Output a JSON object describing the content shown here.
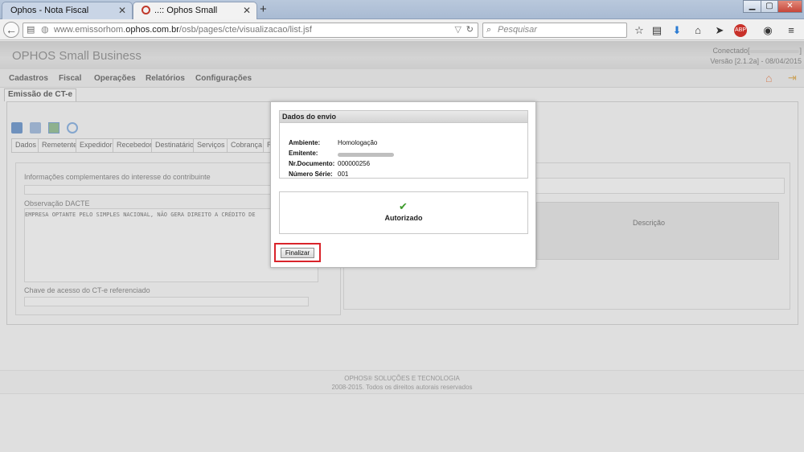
{
  "browser": {
    "tabs": [
      {
        "label": "Ophos - Nota Fiscal Eletrônica",
        "active": false
      },
      {
        "label": "..:: Ophos Small Business",
        "active": true
      }
    ],
    "new_tab_label": "+",
    "url_prefix": "www.emissorhom.",
    "url_domain": "ophos.com.br",
    "url_path": "/osb/pages/cte/visualizacao/list.jsf",
    "search_placeholder": "Pesquisar"
  },
  "app": {
    "brand": "OPHOS Small Business",
    "connected_label": "Conectado[",
    "connected_suffix": "]",
    "version": "Versão [2.1.2a] - 08/04/2015",
    "menu": [
      "Cadastros",
      "Fiscal",
      "Operações",
      "Relatórios",
      "Configurações"
    ],
    "page_tab": "Emissão de CT-e",
    "inner_tabs": [
      "Dados",
      "Remetente",
      "Expedidor",
      "Recebedor",
      "Destinatário",
      "Serviços",
      "Cobrança",
      "R"
    ],
    "form": {
      "info_label": "Informações complementares do interesse do contribuinte",
      "obs_label": "Observação DACTE",
      "obs_text": "EMPRESA OPTANTE PELO SIMPLES NACIONAL, NÃO GERA DIREITO A CRÉDITO DE",
      "chave_label": "Chave de acesso do CT-e referenciado"
    },
    "grid_header": "Descrição"
  },
  "modal": {
    "title": "Dados do envio",
    "fields": [
      {
        "label": "Ambiente:",
        "value": "Homologação"
      },
      {
        "label": "Emitente:",
        "value": ""
      },
      {
        "label": "Nr.Documento:",
        "value": "000000256"
      },
      {
        "label": "Número Série:",
        "value": "001"
      }
    ],
    "status": "Autorizado",
    "button": "Finalizar"
  },
  "footer": {
    "line1": "OPHOS® SOLUÇÕES E TECNOLOGIA",
    "line2": "2008-2015. Todos os direitos autorais reservados"
  },
  "colors": {
    "highlight": "#d9242b",
    "check": "#3c9a2b"
  }
}
